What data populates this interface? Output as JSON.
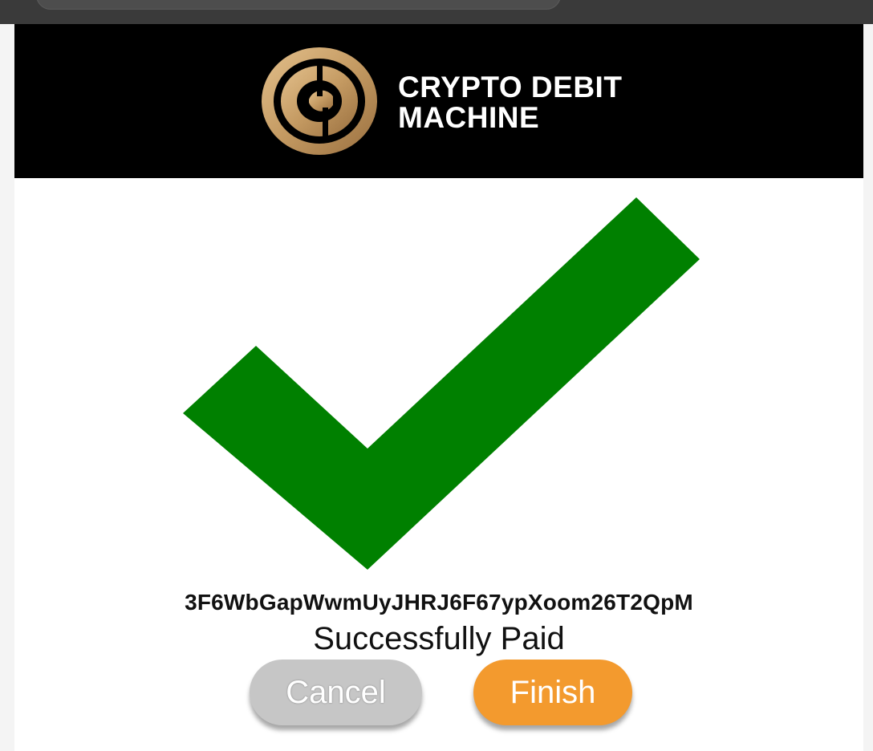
{
  "brand": {
    "line1": "CRYPTO DEBIT",
    "line2": "MACHINE",
    "logo_icon": "cdm-coin-logo-icon",
    "logo_color": "#c9a069"
  },
  "payment": {
    "address": "3F6WbGapWwmUyJHRJ6F67ypXoom26T2QpM",
    "status": "Successfully Paid",
    "status_icon": "checkmark-icon",
    "status_color": "#008000"
  },
  "actions": {
    "cancel_label": "Cancel",
    "finish_label": "Finish",
    "cancel_color": "#c6c6c6",
    "finish_color": "#f39a2e"
  }
}
